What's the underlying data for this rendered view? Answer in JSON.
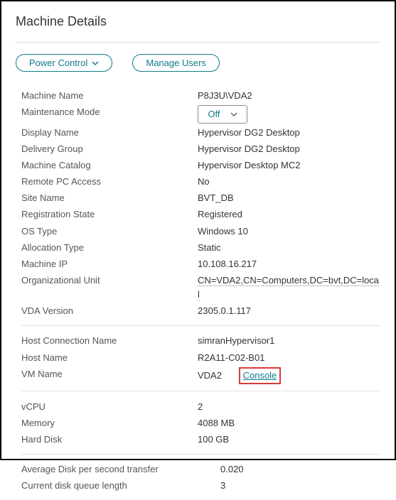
{
  "title": "Machine Details",
  "buttons": {
    "power_control": "Power Control",
    "manage_users": "Manage Users"
  },
  "sections": {
    "general": {
      "machine_name": {
        "label": "Machine Name",
        "value": "P8J3U\\VDA2"
      },
      "maintenance_mode": {
        "label": "Maintenance Mode",
        "value": "Off"
      },
      "display_name": {
        "label": "Display Name",
        "value": "Hypervisor DG2 Desktop"
      },
      "delivery_group": {
        "label": "Delivery Group",
        "value": "Hypervisor DG2 Desktop"
      },
      "machine_catalog": {
        "label": "Machine Catalog",
        "value": "Hypervisor Desktop MC2"
      },
      "remote_pc": {
        "label": "Remote PC Access",
        "value": "No"
      },
      "site_name": {
        "label": "Site Name",
        "value": "BVT_DB"
      },
      "reg_state": {
        "label": "Registration State",
        "value": "Registered"
      },
      "os_type": {
        "label": "OS Type",
        "value": "Windows 10"
      },
      "alloc_type": {
        "label": "Allocation Type",
        "value": "Static"
      },
      "machine_ip": {
        "label": "Machine IP",
        "value": "10.108.16.217"
      },
      "org_unit": {
        "label": "Organizational Unit",
        "value": "CN=VDA2,CN=Computers,DC=bvt,DC=local"
      },
      "vda_version": {
        "label": "VDA Version",
        "value": "2305.0.1.117"
      }
    },
    "host": {
      "host_conn": {
        "label": "Host Connection Name",
        "value": "simranHypervisor1"
      },
      "host_name": {
        "label": "Host Name",
        "value": "R2A11-C02-B01"
      },
      "vm_name": {
        "label": "VM Name",
        "value": "VDA2",
        "console": "Console"
      }
    },
    "resources": {
      "vcpu": {
        "label": "vCPU",
        "value": "2"
      },
      "memory": {
        "label": "Memory",
        "value": "4088 MB"
      },
      "hard_disk": {
        "label": "Hard Disk",
        "value": "100 GB"
      }
    },
    "disk": {
      "avg_transfer": {
        "label": "Average Disk per second transfer",
        "value": "0.020"
      },
      "queue_length": {
        "label": "Current disk queue length",
        "value": "3"
      }
    }
  }
}
